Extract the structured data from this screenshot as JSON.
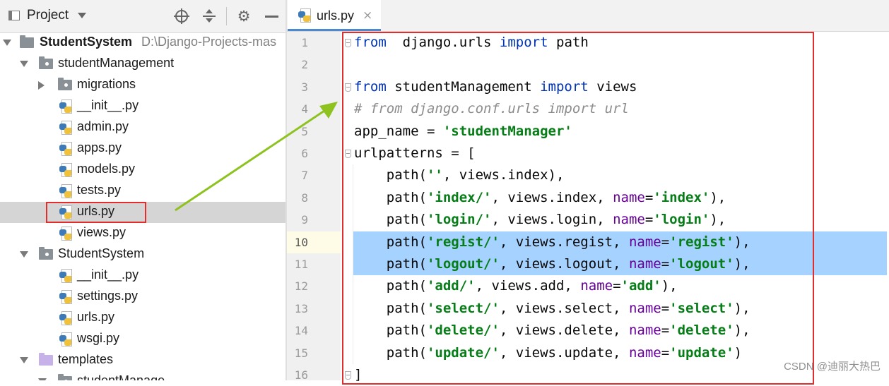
{
  "project_panel": {
    "title": "Project",
    "tree": [
      {
        "label": "StudentSystem",
        "path": "D:\\Django-Projects-mas",
        "kind": "project-folder",
        "expanded": true
      },
      {
        "label": "studentManagement",
        "kind": "folder",
        "expanded": true
      },
      {
        "label": "migrations",
        "kind": "folder",
        "expanded": false
      },
      {
        "label": "__init__.py",
        "kind": "python-file"
      },
      {
        "label": "admin.py",
        "kind": "python-file"
      },
      {
        "label": "apps.py",
        "kind": "python-file"
      },
      {
        "label": "models.py",
        "kind": "python-file"
      },
      {
        "label": "tests.py",
        "kind": "python-file"
      },
      {
        "label": "urls.py",
        "kind": "python-file",
        "selected": true
      },
      {
        "label": "views.py",
        "kind": "python-file"
      },
      {
        "label": "StudentSystem",
        "kind": "folder",
        "expanded": true
      },
      {
        "label": "__init__.py",
        "kind": "python-file"
      },
      {
        "label": "settings.py",
        "kind": "python-file"
      },
      {
        "label": "urls.py",
        "kind": "python-file"
      },
      {
        "label": "wsgi.py",
        "kind": "python-file"
      },
      {
        "label": "templates",
        "kind": "template-folder",
        "expanded": true
      },
      {
        "label": "studentManage",
        "kind": "folder",
        "expanded": true
      }
    ]
  },
  "editor": {
    "tab": {
      "label": "urls.py",
      "close": "×"
    },
    "current_line": 10,
    "selected_lines": [
      10,
      11
    ],
    "lines": [
      {
        "no": "1",
        "tokens": [
          [
            "kw",
            "from"
          ],
          [
            "",
            "  django.urls "
          ],
          [
            "kw",
            "import"
          ],
          [
            "",
            " path"
          ]
        ]
      },
      {
        "no": "2",
        "tokens": []
      },
      {
        "no": "3",
        "tokens": [
          [
            "kw",
            "from"
          ],
          [
            "",
            " studentManagement "
          ],
          [
            "kw",
            "import"
          ],
          [
            "",
            " views"
          ]
        ]
      },
      {
        "no": "4",
        "tokens": [
          [
            "cmt",
            "# from django.conf.urls import url"
          ]
        ]
      },
      {
        "no": "5",
        "tokens": [
          [
            "",
            "app_name = "
          ],
          [
            "str",
            "'studentManager'"
          ]
        ]
      },
      {
        "no": "6",
        "tokens": [
          [
            "",
            "urlpatterns = ["
          ]
        ]
      },
      {
        "no": "7",
        "tokens": [
          [
            "",
            "    path("
          ],
          [
            "str",
            "''"
          ],
          [
            "",
            ", views.index),"
          ]
        ]
      },
      {
        "no": "8",
        "tokens": [
          [
            "",
            "    path("
          ],
          [
            "str",
            "'index/'"
          ],
          [
            "",
            ", views.index, "
          ],
          [
            "param",
            "name"
          ],
          [
            "",
            "="
          ],
          [
            "str",
            "'index'"
          ],
          [
            "",
            "),"
          ]
        ]
      },
      {
        "no": "9",
        "tokens": [
          [
            "",
            "    path("
          ],
          [
            "str",
            "'login/'"
          ],
          [
            "",
            ", views.login, "
          ],
          [
            "param",
            "name"
          ],
          [
            "",
            "="
          ],
          [
            "str",
            "'login'"
          ],
          [
            "",
            "),"
          ]
        ]
      },
      {
        "no": "10",
        "tokens": [
          [
            "",
            "    path("
          ],
          [
            "str",
            "'regist/'"
          ],
          [
            "",
            ", views.regist, "
          ],
          [
            "param",
            "name"
          ],
          [
            "",
            "="
          ],
          [
            "str",
            "'regist'"
          ],
          [
            "",
            "),"
          ]
        ]
      },
      {
        "no": "11",
        "tokens": [
          [
            "",
            "    path("
          ],
          [
            "str",
            "'logout/'"
          ],
          [
            "",
            ", views.logout, "
          ],
          [
            "param",
            "name"
          ],
          [
            "",
            "="
          ],
          [
            "str",
            "'logout'"
          ],
          [
            "",
            "),"
          ]
        ]
      },
      {
        "no": "12",
        "tokens": [
          [
            "",
            "    path("
          ],
          [
            "str",
            "'add/'"
          ],
          [
            "",
            ", views.add, "
          ],
          [
            "param",
            "name"
          ],
          [
            "",
            "="
          ],
          [
            "str",
            "'add'"
          ],
          [
            "",
            "),"
          ]
        ]
      },
      {
        "no": "13",
        "tokens": [
          [
            "",
            "    path("
          ],
          [
            "str",
            "'select/'"
          ],
          [
            "",
            ", views.select, "
          ],
          [
            "param",
            "name"
          ],
          [
            "",
            "="
          ],
          [
            "str",
            "'select'"
          ],
          [
            "",
            "),"
          ]
        ]
      },
      {
        "no": "14",
        "tokens": [
          [
            "",
            "    path("
          ],
          [
            "str",
            "'delete/'"
          ],
          [
            "",
            ", views.delete, "
          ],
          [
            "param",
            "name"
          ],
          [
            "",
            "="
          ],
          [
            "str",
            "'delete'"
          ],
          [
            "",
            "),"
          ]
        ]
      },
      {
        "no": "15",
        "tokens": [
          [
            "",
            "    path("
          ],
          [
            "str",
            "'update/'"
          ],
          [
            "",
            ", views.update, "
          ],
          [
            "param",
            "name"
          ],
          [
            "",
            "="
          ],
          [
            "str",
            "'update'"
          ],
          [
            "",
            ")"
          ]
        ]
      },
      {
        "no": "16",
        "tokens": [
          [
            "",
            "]"
          ]
        ]
      }
    ]
  },
  "watermark": "CSDN @迪丽大热巴",
  "colors": {
    "annotation_red": "#e02d2d",
    "annotation_arrow": "#8dc21f",
    "selection": "#a6d2ff",
    "keyword": "#0033b3",
    "string": "#067d17",
    "comment": "#8c8c8c",
    "param": "#660099"
  }
}
